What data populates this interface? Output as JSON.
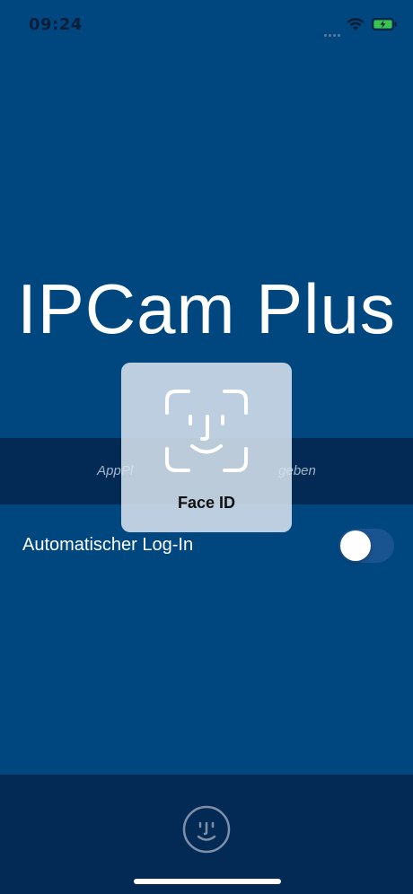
{
  "status_bar": {
    "time": "09:24",
    "wifi_icon": "wifi-icon",
    "battery_icon": "battery-charging-icon"
  },
  "app": {
    "title": "IPCam Plus"
  },
  "info_band": {
    "text_left": "AppPl",
    "text_right": "geben"
  },
  "auto_login": {
    "label": "Automatischer Log-In",
    "enabled": false
  },
  "faceid_overlay": {
    "label": "Face ID",
    "icon": "face-id-icon"
  },
  "bottom_bar": {
    "button_icon": "face-id-icon"
  },
  "colors": {
    "background": "#00467f",
    "band": "#032a55",
    "overlay": "#d6e1ed",
    "battery_green": "#3cc54a"
  }
}
